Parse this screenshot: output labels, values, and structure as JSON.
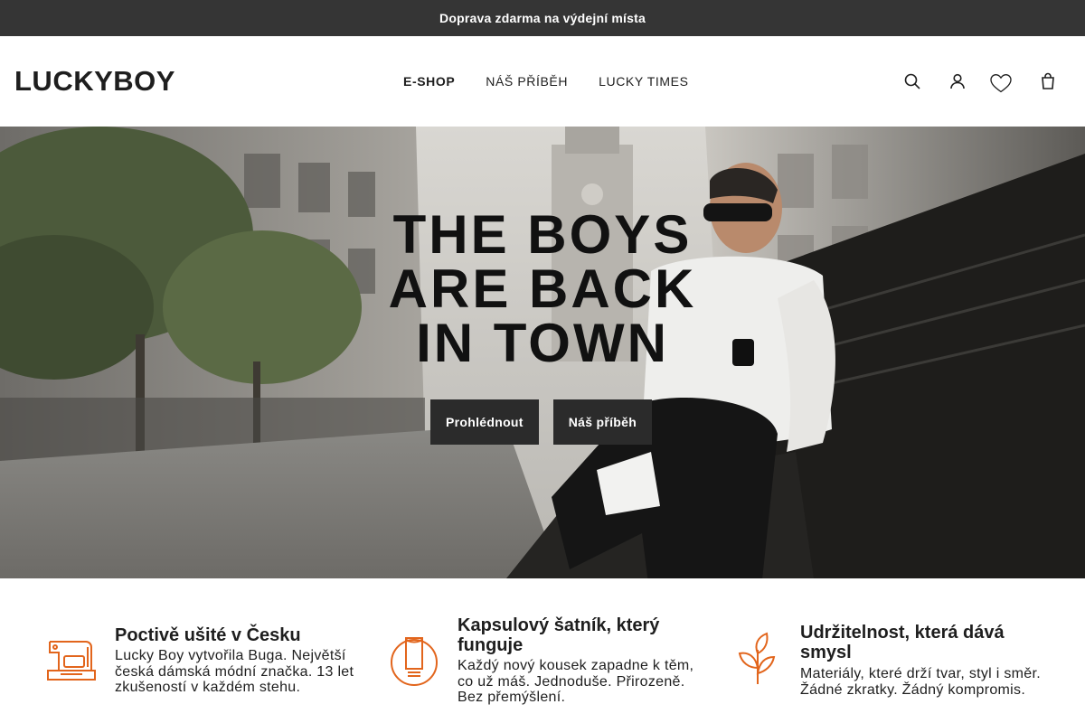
{
  "topbar": {
    "text": "Doprava zdarma na výdejní místa"
  },
  "header": {
    "logo": "LUCKYBOY",
    "nav": [
      {
        "label": "E-SHOP",
        "active": true
      },
      {
        "label": "NÁŠ PŘÍBĚH",
        "active": false
      },
      {
        "label": "LUCKY TIMES",
        "active": false
      }
    ],
    "icons": [
      "search-icon",
      "user-icon",
      "heart-icon",
      "cart-icon"
    ]
  },
  "hero": {
    "title_lines": [
      "THE BOYS",
      "ARE BACK",
      "IN TOWN"
    ],
    "buttons": [
      {
        "label": "Prohlédnout"
      },
      {
        "label": "Náš příběh"
      }
    ]
  },
  "features": [
    {
      "icon": "sewing-machine-icon",
      "title": "Poctivě ušité v Česku",
      "text": "Lucky Boy vytvořila Buga. Největší česká dámská módní značka. 13 let zkušeností v každém stehu."
    },
    {
      "icon": "tshirt-icon",
      "title": "Kapsulový šatník, který funguje",
      "text": "Každý nový kousek zapadne k těm, co už máš. Jednoduše. Přirozeně. Bez přemýšlení."
    },
    {
      "icon": "leaf-icon",
      "title": "Udržitelnost, která dává smysl",
      "text": "Materiály, které drží tvar, styl i směr. Žádné zkratky. Žádný kompromis."
    }
  ],
  "colors": {
    "accent": "#e2651c",
    "button": "#2b2b2b",
    "topbar": "#353535"
  }
}
